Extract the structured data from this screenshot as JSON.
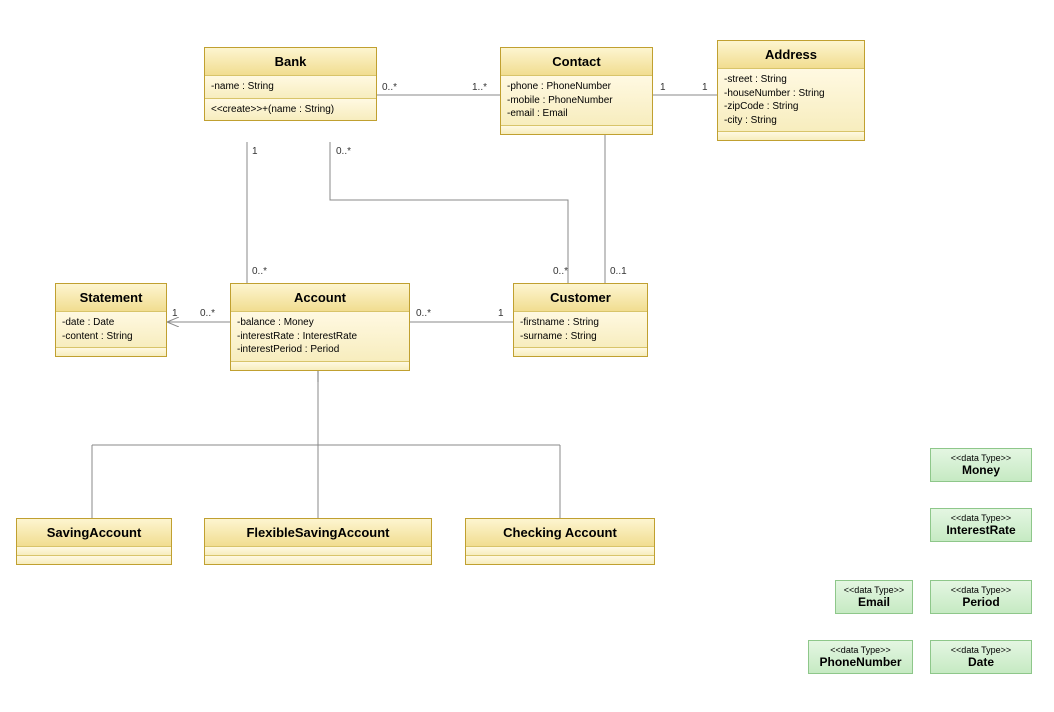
{
  "classes": {
    "bank": {
      "name": "Bank",
      "attrs": [
        "-name : String"
      ],
      "ops": [
        "<<create>>+(name : String)"
      ]
    },
    "contact": {
      "name": "Contact",
      "attrs": [
        "-phone : PhoneNumber",
        "-mobile : PhoneNumber",
        "-email : Email"
      ],
      "ops": []
    },
    "address": {
      "name": "Address",
      "attrs": [
        "-street : String",
        "-houseNumber : String",
        "-zipCode : String",
        "-city : String"
      ],
      "ops": []
    },
    "statement": {
      "name": "Statement",
      "attrs": [
        "-date : Date",
        "-content : String"
      ],
      "ops": []
    },
    "account": {
      "name": "Account",
      "attrs": [
        "-balance : Money",
        "-interestRate : InterestRate",
        "-interestPeriod : Period"
      ],
      "ops": []
    },
    "customer": {
      "name": "Customer",
      "attrs": [
        "-firstname : String",
        "-surname : String"
      ],
      "ops": []
    },
    "saving": {
      "name": "SavingAccount",
      "attrs": [],
      "ops": []
    },
    "flexible": {
      "name": "FlexibleSavingAccount",
      "attrs": [],
      "ops": []
    },
    "checking": {
      "name": "Checking Account",
      "attrs": [],
      "ops": []
    }
  },
  "datatypes": {
    "money": {
      "stereo": "<<data Type>>",
      "name": "Money"
    },
    "interestRate": {
      "stereo": "<<data Type>>",
      "name": "InterestRate"
    },
    "period": {
      "stereo": "<<data Type>>",
      "name": "Period"
    },
    "email": {
      "stereo": "<<data Type>>",
      "name": "Email"
    },
    "phoneNumber": {
      "stereo": "<<data Type>>",
      "name": "PhoneNumber"
    },
    "date": {
      "stereo": "<<data Type>>",
      "name": "Date"
    }
  },
  "mults": {
    "bank_contact_left": "0..*",
    "bank_contact_right": "1..*",
    "contact_address_left": "1",
    "contact_address_right": "1",
    "bank_account_top": "1",
    "bank_account_bot": "0..*",
    "bank_customer_top": "0..*",
    "bank_customer_bot": "0..*",
    "contact_customer_bot": "0..1",
    "account_statement_right": "0..*",
    "account_statement_left": "1",
    "account_customer_left": "0..*",
    "account_customer_right": "1"
  }
}
